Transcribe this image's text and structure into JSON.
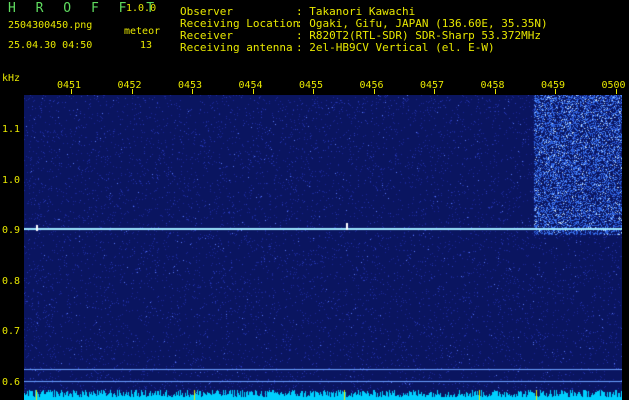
{
  "app": {
    "title": "H R O F F T",
    "version": "1.0.0",
    "filename": "2504300450.png",
    "datetime": "25.04.30 04:50",
    "meteor_label": "meteor",
    "meteor_count": "13"
  },
  "info": {
    "rows": [
      {
        "label": "Observer",
        "value": ": Takanori Kawachi"
      },
      {
        "label": "Receiving Location",
        "value": ": Ogaki, Gifu, JAPAN (136.60E, 35.35N)"
      },
      {
        "label": "Receiver",
        "value": ": R820T2(RTL-SDR) SDR-Sharp 53.372MHz"
      },
      {
        "label": "Receiving antenna",
        "value": ": 2el-HB9CV Vertical (el. E-W)"
      }
    ]
  },
  "spectrogram": {
    "unit_label": "kHz",
    "time_ticks": [
      "0451",
      "0452",
      "0453",
      "0454",
      "0455",
      "0456",
      "0457",
      "0458",
      "0459",
      "0500"
    ],
    "freq_ticks": [
      "1.1",
      "1.0",
      "0.9",
      "0.8",
      "0.7",
      "0.6"
    ],
    "beacon_freq_khz": 0.9,
    "background_color": "#0a1a66",
    "beacon_color": "#9fe8ff",
    "burst_color": "#4aa0ff",
    "noise_floor_color": "#00d0ff"
  }
}
